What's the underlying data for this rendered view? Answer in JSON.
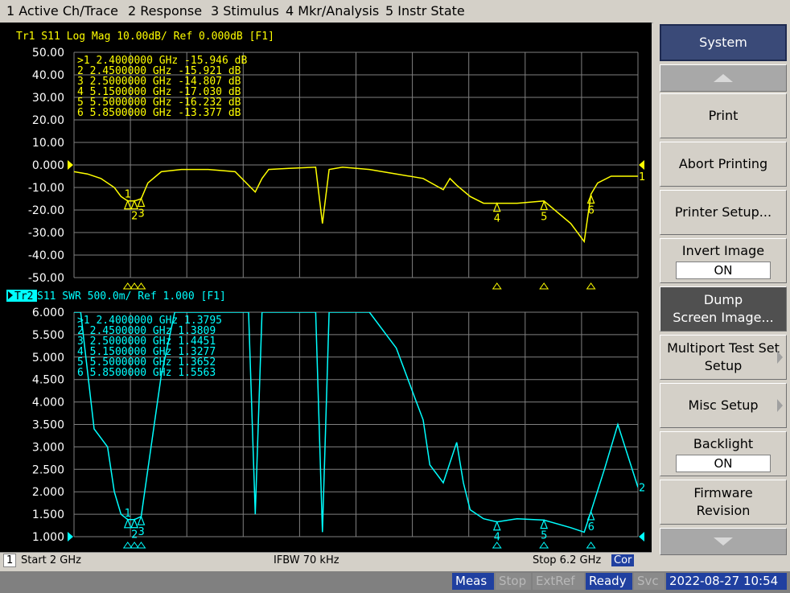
{
  "menu": [
    "1 Active Ch/Trace",
    "2 Response",
    "3 Stimulus",
    "4 Mkr/Analysis",
    "5 Instr State"
  ],
  "tr1": {
    "header": "Tr1  S11  Log Mag 10.00dB/ Ref 0.000dB [F1]",
    "yticks": [
      "50.00",
      "40.00",
      "30.00",
      "20.00",
      "10.00",
      "0.000",
      "-10.00",
      "-20.00",
      "-30.00",
      "-40.00",
      "-50.00"
    ],
    "markers": [
      ">1   2.4000000 GHz  -15.946 dB",
      " 2   2.4500000 GHz  -15.921 dB",
      " 3   2.5000000 GHz  -14.807 dB",
      " 4   5.1500000 GHz  -17.030 dB",
      " 5   5.5000000 GHz  -16.232 dB",
      " 6   5.8500000 GHz  -13.377 dB"
    ],
    "color": "#ffff00",
    "trace_end_label": "1"
  },
  "tr2": {
    "header_tag": "Tr2",
    "header": " S11  SWR 500.0m/ Ref 1.000 [F1]",
    "yticks": [
      "6.000",
      "5.500",
      "5.000",
      "4.500",
      "4.000",
      "3.500",
      "3.000",
      "2.500",
      "2.000",
      "1.500",
      "1.000"
    ],
    "markers": [
      ">1   2.4000000 GHz   1.3795",
      " 2   2.4500000 GHz   1.3809",
      " 3   2.5000000 GHz   1.4451",
      " 4   5.1500000 GHz   1.3277",
      " 5   5.5000000 GHz   1.3652",
      " 6   5.8500000 GHz   1.5563"
    ],
    "color": "#00ffff",
    "trace_end_label": "2"
  },
  "marker_labels": [
    "1",
    "2",
    "3",
    "4",
    "5",
    "6"
  ],
  "footer": {
    "channel": "1",
    "start": "Start 2 GHz",
    "ifbw": "IFBW 70 kHz",
    "stop": "Stop 6.2 GHz",
    "cor": "Cor"
  },
  "softkeys": {
    "title": "System",
    "print": "Print",
    "abort": "Abort Printing",
    "printer_setup": "Printer Setup...",
    "invert_image": "Invert Image",
    "invert_value": "ON",
    "dump1": "Dump",
    "dump2": "Screen Image...",
    "multiport1": "Multiport Test Set",
    "multiport2": "Setup",
    "misc": "Misc Setup",
    "backlight": "Backlight",
    "backlight_value": "ON",
    "firmware1": "Firmware",
    "firmware2": "Revision"
  },
  "status": {
    "meas": "Meas",
    "stop": "Stop",
    "extref": "ExtRef",
    "ready": "Ready",
    "svc": "Svc",
    "datetime": "2022-08-27 10:54"
  },
  "chart_data": [
    {
      "type": "line",
      "title": "Tr1  S11  Log Mag 10.00dB/ Ref 0.000dB [F1]",
      "x_unit": "GHz",
      "xlim": [
        2.0,
        6.2
      ],
      "ylim": [
        -50,
        50
      ],
      "ylabel": "dB",
      "series": [
        {
          "name": "S11 Log Mag",
          "x": [
            2.0,
            2.1,
            2.2,
            2.3,
            2.35,
            2.4,
            2.45,
            2.5,
            2.55,
            2.65,
            2.8,
            3.0,
            3.2,
            3.35,
            3.4,
            3.45,
            3.6,
            3.8,
            3.85,
            3.9,
            4.0,
            4.2,
            4.4,
            4.6,
            4.75,
            4.8,
            4.85,
            4.95,
            5.05,
            5.15,
            5.3,
            5.5,
            5.7,
            5.8,
            5.85,
            5.9,
            6.0,
            6.2
          ],
          "y": [
            -3,
            -4,
            -6,
            -10,
            -14,
            -16,
            -16,
            -15,
            -8,
            -3,
            -2,
            -2,
            -3,
            -12,
            -6,
            -2,
            -1.5,
            -1,
            -26,
            -2,
            -1,
            -2,
            -4,
            -6,
            -11,
            -6,
            -9,
            -14,
            -17,
            -17,
            -17,
            -16,
            -26,
            -34,
            -13,
            -8,
            -5,
            -5
          ]
        }
      ],
      "markers": [
        [
          2.4,
          -15.946
        ],
        [
          2.45,
          -15.921
        ],
        [
          2.5,
          -14.807
        ],
        [
          5.15,
          -17.03
        ],
        [
          5.5,
          -16.232
        ],
        [
          5.85,
          -13.377
        ]
      ]
    },
    {
      "type": "line",
      "title": "Tr2 S11  SWR 500.0m/ Ref 1.000 [F1]",
      "x_unit": "GHz",
      "xlim": [
        2.0,
        6.2
      ],
      "ylim": [
        1.0,
        6.0
      ],
      "ylabel": "SWR",
      "series": [
        {
          "name": "S11 SWR",
          "x": [
            2.0,
            2.05,
            2.15,
            2.25,
            2.3,
            2.35,
            2.4,
            2.45,
            2.5,
            2.55,
            2.65,
            2.75,
            3.0,
            3.2,
            3.3,
            3.35,
            3.4,
            3.45,
            3.6,
            3.8,
            3.85,
            3.9,
            4.0,
            4.2,
            4.4,
            4.55,
            4.6,
            4.65,
            4.75,
            4.85,
            4.9,
            4.95,
            5.05,
            5.15,
            5.3,
            5.5,
            5.7,
            5.8,
            5.85,
            5.95,
            6.05,
            6.2
          ],
          "y": [
            6,
            6,
            3.4,
            3.0,
            2.0,
            1.5,
            1.38,
            1.38,
            1.45,
            2.5,
            4.6,
            6,
            6,
            6,
            6,
            1.5,
            6,
            6,
            6,
            6,
            1.1,
            6,
            6,
            6,
            5.2,
            4.0,
            3.6,
            2.6,
            2.2,
            3.1,
            2.2,
            1.6,
            1.4,
            1.33,
            1.4,
            1.37,
            1.2,
            1.1,
            1.56,
            2.5,
            3.5,
            2.1
          ]
        }
      ],
      "markers": [
        [
          2.4,
          1.3795
        ],
        [
          2.45,
          1.3809
        ],
        [
          2.5,
          1.4451
        ],
        [
          5.15,
          1.3277
        ],
        [
          5.5,
          1.3652
        ],
        [
          5.85,
          1.5563
        ]
      ]
    }
  ]
}
